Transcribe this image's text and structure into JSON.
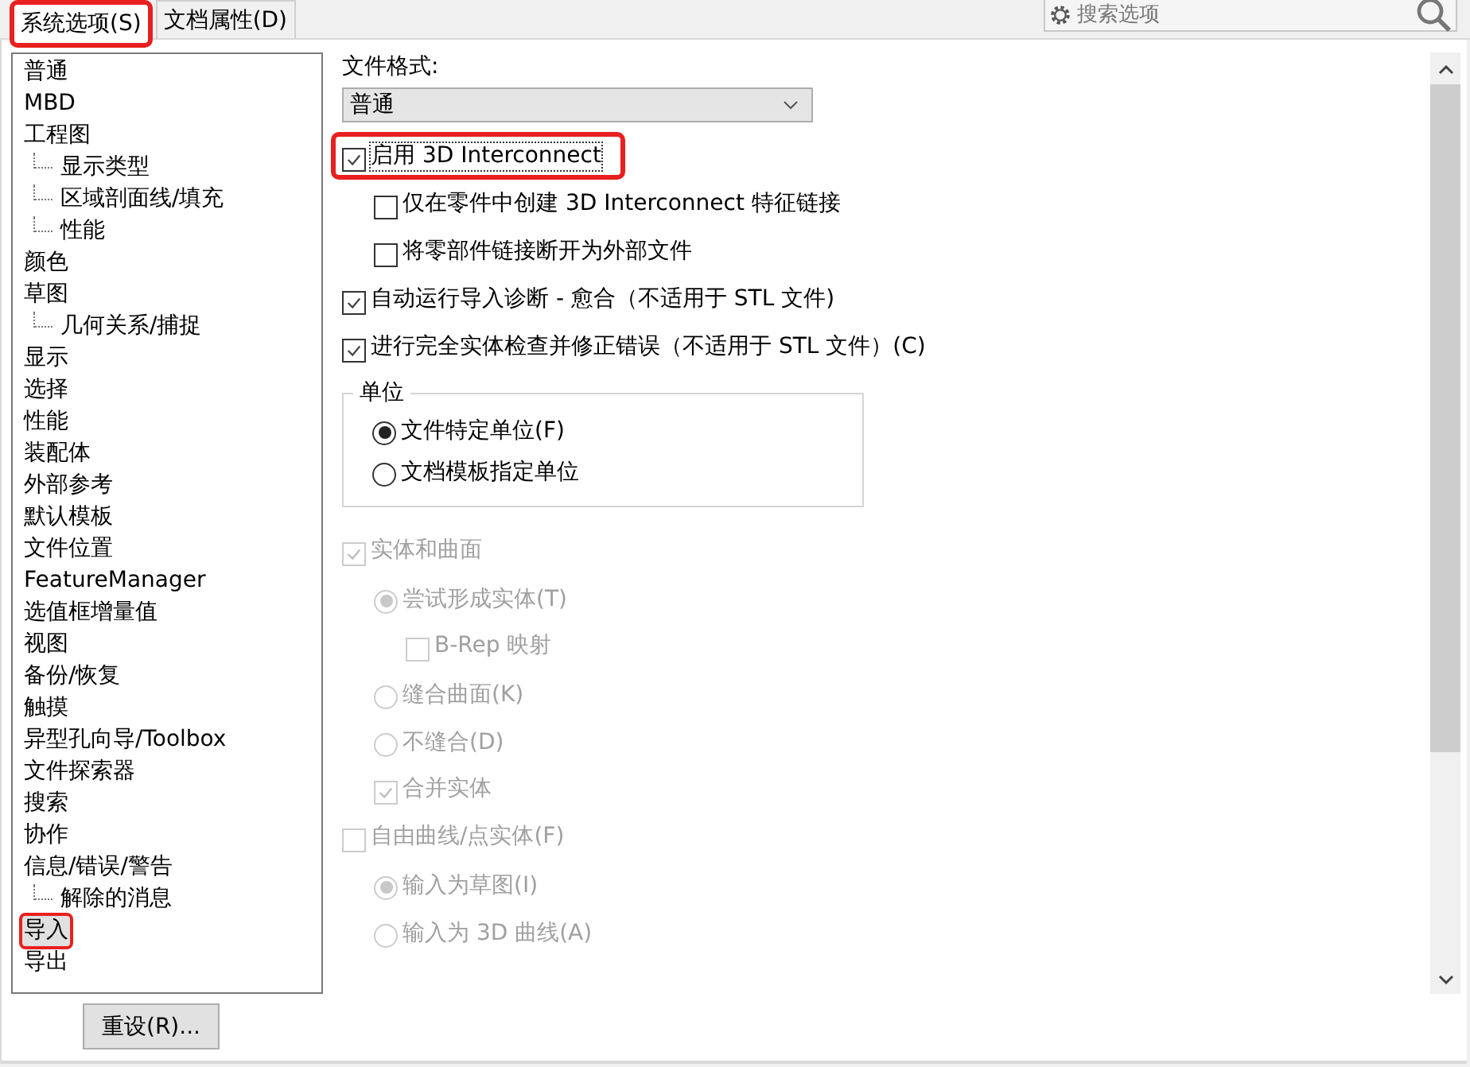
{
  "tabs": [
    {
      "label": "系统选项(S)",
      "selected": true,
      "highlighted": true
    },
    {
      "label": "文档属性(D)",
      "selected": false,
      "highlighted": false
    }
  ],
  "search": {
    "placeholder": "搜索选项"
  },
  "tree": [
    {
      "label": "普通",
      "selected": false,
      "highlighted": false
    },
    {
      "label": "MBD",
      "selected": false,
      "highlighted": false
    },
    {
      "label": "工程图",
      "selected": false,
      "highlighted": false,
      "children": [
        {
          "label": "显示类型",
          "selected": false,
          "highlighted": false
        },
        {
          "label": "区域剖面线/填充",
          "selected": false,
          "highlighted": false
        },
        {
          "label": "性能",
          "selected": false,
          "highlighted": false
        }
      ]
    },
    {
      "label": "颜色",
      "selected": false,
      "highlighted": false
    },
    {
      "label": "草图",
      "selected": false,
      "highlighted": false,
      "children": [
        {
          "label": "几何关系/捕捉",
          "selected": false,
          "highlighted": false
        }
      ]
    },
    {
      "label": "显示",
      "selected": false,
      "highlighted": false
    },
    {
      "label": "选择",
      "selected": false,
      "highlighted": false
    },
    {
      "label": "性能",
      "selected": false,
      "highlighted": false
    },
    {
      "label": "装配体",
      "selected": false,
      "highlighted": false
    },
    {
      "label": "外部参考",
      "selected": false,
      "highlighted": false
    },
    {
      "label": "默认模板",
      "selected": false,
      "highlighted": false
    },
    {
      "label": "文件位置",
      "selected": false,
      "highlighted": false
    },
    {
      "label": "FeatureManager",
      "selected": false,
      "highlighted": false
    },
    {
      "label": "选值框增量值",
      "selected": false,
      "highlighted": false
    },
    {
      "label": "视图",
      "selected": false,
      "highlighted": false
    },
    {
      "label": "备份/恢复",
      "selected": false,
      "highlighted": false
    },
    {
      "label": "触摸",
      "selected": false,
      "highlighted": false
    },
    {
      "label": "异型孔向导/Toolbox",
      "selected": false,
      "highlighted": false
    },
    {
      "label": "文件探索器",
      "selected": false,
      "highlighted": false
    },
    {
      "label": "搜索",
      "selected": false,
      "highlighted": false
    },
    {
      "label": "协作",
      "selected": false,
      "highlighted": false
    },
    {
      "label": "信息/错误/警告",
      "selected": false,
      "highlighted": false,
      "children": [
        {
          "label": "解除的消息",
          "selected": false,
          "highlighted": false
        }
      ]
    },
    {
      "label": "导入",
      "selected": true,
      "highlighted": true
    },
    {
      "label": "导出",
      "selected": false,
      "highlighted": false
    }
  ],
  "reset_button": "重设(R)...",
  "file_format": {
    "label": "文件格式:",
    "value": "普通"
  },
  "options": [
    {
      "kind": "checkbox",
      "label": "启用 3D Interconnect",
      "checked": true,
      "disabled": false,
      "highlighted": true,
      "children": [
        {
          "kind": "checkbox",
          "label": "仅在零件中创建 3D Interconnect 特征链接",
          "checked": false,
          "disabled": false,
          "highlighted": false
        },
        {
          "kind": "checkbox",
          "label": "将零部件链接断开为外部文件",
          "checked": false,
          "disabled": false,
          "highlighted": false
        }
      ]
    },
    {
      "kind": "checkbox",
      "label": "自动运行导入诊断 - 愈合（不适用于 STL 文件)",
      "checked": true,
      "disabled": false,
      "highlighted": false
    },
    {
      "kind": "checkbox",
      "label": "进行完全实体检查并修正错误（不适用于 STL 文件）(C)",
      "checked": true,
      "disabled": false,
      "highlighted": false
    },
    {
      "kind": "group",
      "label": "单位",
      "children": [
        {
          "kind": "radio",
          "label": "文件特定单位(F)",
          "selected": true,
          "disabled": false
        },
        {
          "kind": "radio",
          "label": "文档模板指定单位",
          "selected": false,
          "disabled": false
        }
      ]
    },
    {
      "kind": "checkbox",
      "label": "实体和曲面",
      "checked": true,
      "disabled": true,
      "highlighted": false,
      "children": [
        {
          "kind": "radio",
          "label": "尝试形成实体(T)",
          "selected": true,
          "disabled": true,
          "highlighted": false,
          "children": [
            {
              "kind": "checkbox",
              "label": "B-Rep 映射",
              "checked": false,
              "disabled": true,
              "highlighted": false
            }
          ]
        },
        {
          "kind": "radio",
          "label": "缝合曲面(K)",
          "selected": false,
          "disabled": true,
          "highlighted": false
        },
        {
          "kind": "radio",
          "label": "不缝合(D)",
          "selected": false,
          "disabled": true,
          "highlighted": false
        },
        {
          "kind": "checkbox",
          "label": "合并实体",
          "checked": true,
          "disabled": true,
          "highlighted": false
        }
      ]
    },
    {
      "kind": "checkbox",
      "label": "自由曲线/点实体(F)",
      "checked": false,
      "disabled": true,
      "highlighted": false,
      "children": [
        {
          "kind": "radio",
          "label": "输入为草图(I)",
          "selected": true,
          "disabled": true,
          "highlighted": false
        },
        {
          "kind": "radio",
          "label": "输入为 3D 曲线(A)",
          "selected": false,
          "disabled": true,
          "highlighted": false
        }
      ]
    }
  ]
}
